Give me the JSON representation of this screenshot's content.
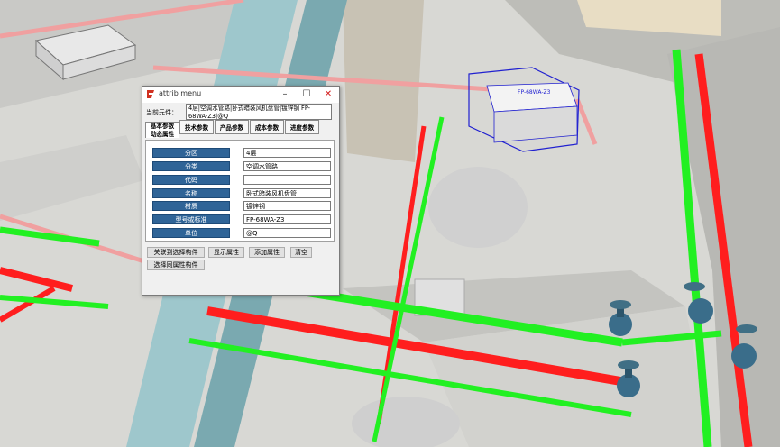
{
  "window": {
    "title": "attrib menu"
  },
  "current": {
    "label": "当前元件：",
    "value": "4层|空调水管路|卧式暗装风机盘管|镀锌钢 FP-68WA-Z3|@Q"
  },
  "tabs": [
    "基本参数",
    "技术参数",
    "产品参数",
    "成本参数",
    "进度参数"
  ],
  "subtab": "动态属性",
  "fields": [
    {
      "label": "分区",
      "value": "4层"
    },
    {
      "label": "分类",
      "value": "空调水管路"
    },
    {
      "label": "代码",
      "value": ""
    },
    {
      "label": "名称",
      "value": "卧式暗装风机盘管"
    },
    {
      "label": "材质",
      "value": "镀锌钢"
    },
    {
      "label": "型号或标准",
      "value": "FP-68WA-Z3"
    },
    {
      "label": "单位",
      "value": "@Q"
    }
  ],
  "actions": [
    "关联到选择构件",
    "显示属性",
    "添加属性",
    "清空",
    "选择同属性构件"
  ],
  "scene_label": "FP-68WA-Z3",
  "colors": {
    "pipe_red": "#ff1e1e",
    "pipe_green": "#22f022",
    "pipe_pink": "#f0a0a0",
    "label_blue": "#2f6497"
  }
}
